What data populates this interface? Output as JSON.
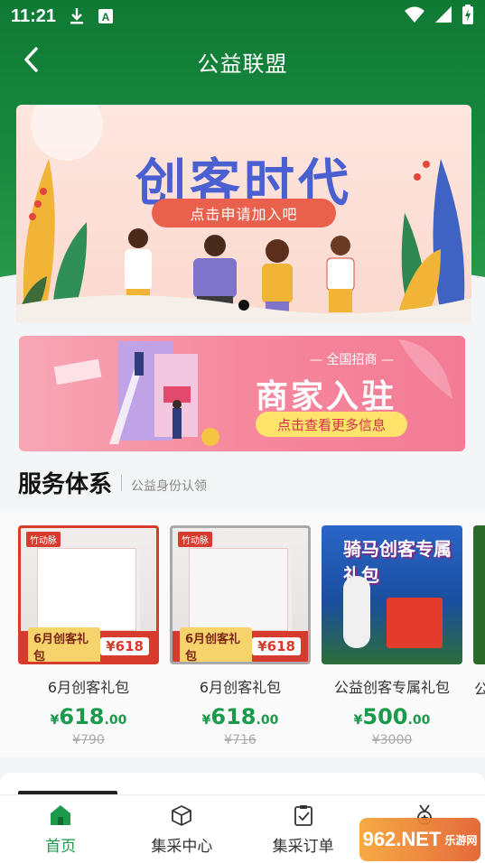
{
  "status_bar": {
    "time": "11:21",
    "icons": [
      "download-icon",
      "a-badge-icon",
      "wifi-icon",
      "signal-icon",
      "battery-charging-icon"
    ]
  },
  "nav": {
    "title": "公益联盟",
    "back_icon": "chevron-left-icon"
  },
  "banners": {
    "main": {
      "title": "创客时代",
      "cta": "点击申请加入吧"
    },
    "merchant": {
      "kicker": "— 全国招商 —",
      "title": "商家入驻",
      "cta": "点击查看更多信息"
    }
  },
  "section": {
    "title": "服务体系",
    "subtitle": "公益身份认领"
  },
  "products": [
    {
      "name": "6月创客礼包",
      "currency": "¥",
      "price_int": "618",
      "price_dec": ".00",
      "original": "¥790",
      "badge_left": "6月创客礼包",
      "badge_right": "¥618",
      "brand": "竹动脉"
    },
    {
      "name": "6月创客礼包",
      "currency": "¥",
      "price_int": "618",
      "price_dec": ".00",
      "original": "¥716",
      "badge_left": "6月创客礼包",
      "badge_right": "¥618",
      "brand": "竹动脉"
    },
    {
      "name": "公益创客专属礼包",
      "currency": "¥",
      "price_int": "500",
      "price_dec": ".00",
      "original": "¥3000",
      "image_title": "骑马创客专属礼包"
    },
    {
      "name": "公"
    }
  ],
  "tabbar": [
    {
      "label": "首页",
      "icon": "home-icon",
      "active": true
    },
    {
      "label": "集采中心",
      "icon": "box-icon",
      "active": false
    },
    {
      "label": "集采订单",
      "icon": "clipboard-check-icon",
      "active": false
    },
    {
      "label": "",
      "icon": "medal-icon",
      "active": false
    }
  ],
  "watermark": {
    "text": "962.NET",
    "sub": "乐游网"
  },
  "colors": {
    "primary_green": "#1a9a4a",
    "header_green": "#0e7a34",
    "banner_red": "#e9604c",
    "accent_yellow": "#ffe36a"
  }
}
